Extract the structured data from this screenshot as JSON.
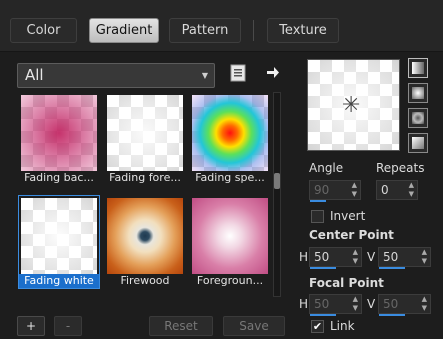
{
  "tabs": [
    {
      "label": "Color",
      "active": false
    },
    {
      "label": "Gradient",
      "active": true
    },
    {
      "label": "Pattern",
      "active": false
    },
    {
      "label": "Texture",
      "active": false
    }
  ],
  "dropdown": {
    "value": "All",
    "caret": "chevron-down-icon"
  },
  "gradients": [
    {
      "label": "Fading bac...",
      "selected": false
    },
    {
      "label": "Fading fore...",
      "selected": false
    },
    {
      "label": "Fading spe...",
      "selected": false
    },
    {
      "label": "Fading white",
      "selected": true
    },
    {
      "label": "Firewood",
      "selected": false
    },
    {
      "label": "Foregroun...",
      "selected": false
    }
  ],
  "bottom_buttons": {
    "add": "+",
    "remove": "-",
    "reset": "Reset",
    "save": "Save"
  },
  "angle": {
    "label": "Angle",
    "value": "90"
  },
  "repeats": {
    "label": "Repeats",
    "value": "0"
  },
  "invert": {
    "label": "Invert",
    "checked": false
  },
  "center_point": {
    "label": "Center Point",
    "h_label": "H",
    "h": "50",
    "v_label": "V",
    "v": "50"
  },
  "focal_point": {
    "label": "Focal Point",
    "h_label": "H",
    "h": "50",
    "v_label": "V",
    "v": "50"
  },
  "link": {
    "label": "Link",
    "checked": true
  },
  "colors": {
    "accent": "#1b6fcc",
    "background": "#1d1d1d"
  }
}
